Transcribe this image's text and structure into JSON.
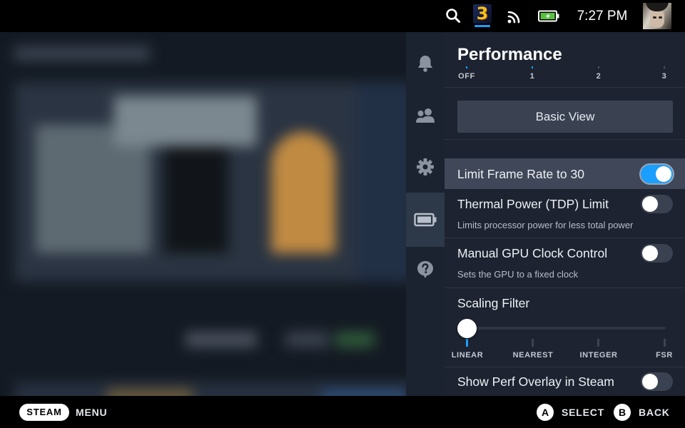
{
  "status_bar": {
    "time": "7:27 PM",
    "current_game_badge": "3",
    "icons": [
      "search-icon",
      "game-thumbnail",
      "wifi-icon",
      "battery-charging-icon",
      "avatar"
    ]
  },
  "quick_access": {
    "tabs": [
      {
        "name": "notifications",
        "icon": "bell-icon"
      },
      {
        "name": "friends",
        "icon": "friends-icon"
      },
      {
        "name": "settings",
        "icon": "gear-icon"
      },
      {
        "name": "performance",
        "icon": "battery-icon",
        "active": true
      },
      {
        "name": "help",
        "icon": "help-icon"
      }
    ]
  },
  "performance": {
    "title": "Performance",
    "overlay_level": {
      "ticks": [
        "OFF",
        "1",
        "2",
        "3"
      ],
      "selected_index": 0
    },
    "basic_view_label": "Basic View",
    "settings": {
      "limit_frame_rate": {
        "label": "Limit Frame Rate to 30",
        "enabled": true
      },
      "tdp_limit": {
        "label": "Thermal Power (TDP) Limit",
        "description": "Limits processor power for less total power",
        "enabled": false
      },
      "manual_gpu_clock": {
        "label": "Manual GPU Clock Control",
        "description": "Sets the GPU to a fixed clock",
        "enabled": false
      },
      "scaling_filter": {
        "label": "Scaling Filter",
        "options": [
          "LINEAR",
          "NEAREST",
          "INTEGER",
          "FSR"
        ],
        "selected_index": 0
      },
      "perf_overlay_in_steam": {
        "label": "Show Perf Overlay in Steam",
        "enabled": false
      }
    }
  },
  "footer": {
    "steam_label": "STEAM",
    "menu_label": "MENU",
    "a_button": "A",
    "select_label": "SELECT",
    "b_button": "B",
    "back_label": "BACK"
  },
  "colors": {
    "accent": "#1a9fff",
    "panel_bg": "#1d2330",
    "rail_bg": "#1b2230",
    "highlight_row": "#3f4758"
  }
}
